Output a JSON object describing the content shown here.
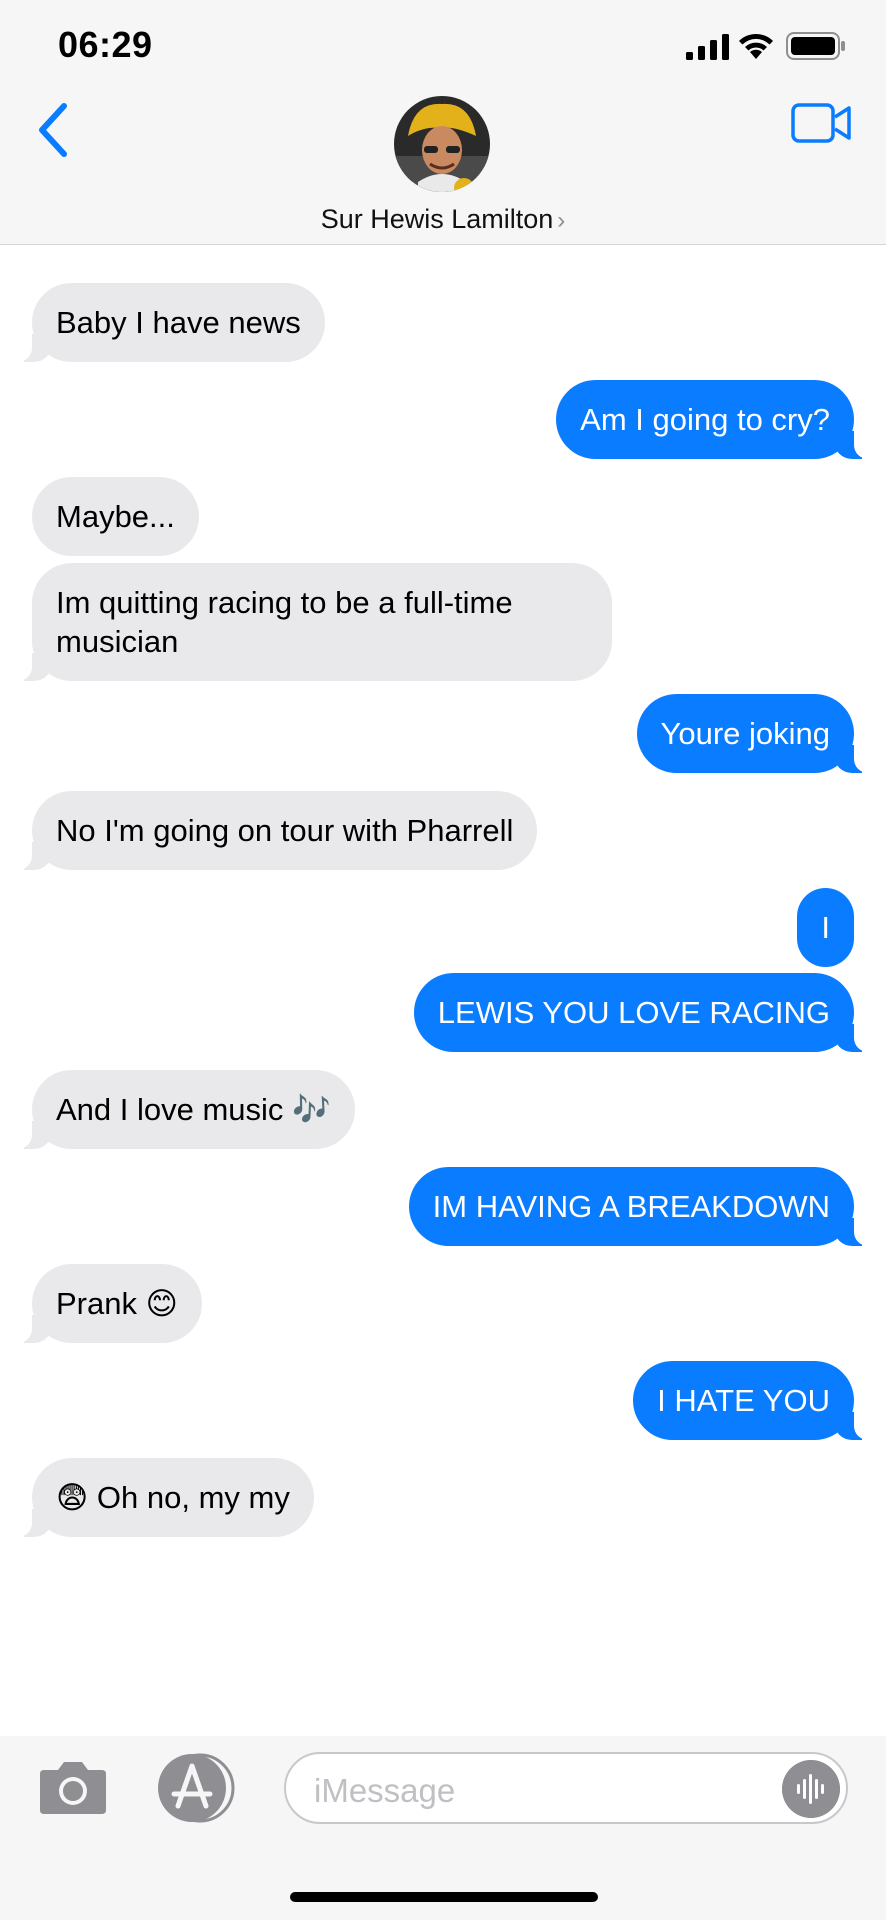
{
  "status_bar": {
    "time": "06:29",
    "signal_icon": "cellular-signal-icon",
    "wifi_icon": "wifi-icon",
    "battery_icon": "battery-icon"
  },
  "header": {
    "contact_name": "Sur Hewis Lamilton",
    "chevron": "›",
    "back_icon": "chevron-left-icon",
    "video_icon": "video-camera-icon",
    "accent_color": "#0a7cff"
  },
  "messages": [
    {
      "from": "them",
      "text": "Baby I have news"
    },
    {
      "from": "me",
      "text": "Am I going to cry?"
    },
    {
      "from": "them",
      "text": "Maybe..."
    },
    {
      "from": "them",
      "text": "Im quitting racing to be a full-time musician"
    },
    {
      "from": "me",
      "text": "Youre joking"
    },
    {
      "from": "them",
      "text": "No I'm going on tour with Pharrell"
    },
    {
      "from": "me",
      "text": "I"
    },
    {
      "from": "me",
      "text": "LEWIS YOU LOVE RACING"
    },
    {
      "from": "them",
      "text": "And I love music 🎶"
    },
    {
      "from": "me",
      "text": "IM HAVING A BREAKDOWN"
    },
    {
      "from": "them",
      "text": "Prank 😊"
    },
    {
      "from": "me",
      "text": "I HATE YOU"
    },
    {
      "from": "them",
      "text": "😨 Oh no, my my"
    }
  ],
  "input_bar": {
    "placeholder": "iMessage",
    "camera_icon": "camera-icon",
    "appstore_icon": "app-store-icon",
    "audio_icon": "audio-waveform-icon"
  },
  "colors": {
    "sent_bubble": "#0a7cff",
    "received_bubble": "#e9e9eb"
  }
}
